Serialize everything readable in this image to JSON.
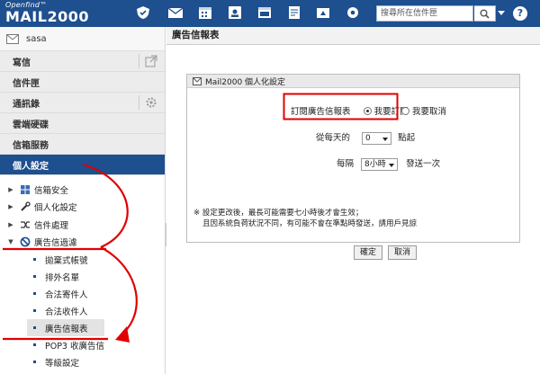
{
  "brand": {
    "top": "Openfind™",
    "name": "MAIL2000"
  },
  "search": {
    "placeholder": "搜尋所在信件匣"
  },
  "help": {
    "label": "?"
  },
  "user": {
    "name": "sasa"
  },
  "nav": {
    "items": [
      {
        "label": "寫信"
      },
      {
        "label": "信件匣"
      },
      {
        "label": "通訊錄"
      },
      {
        "label": "雲端硬碟"
      },
      {
        "label": "信箱服務"
      },
      {
        "label": "個人設定"
      }
    ]
  },
  "tree": {
    "items": [
      {
        "label": "信箱安全"
      },
      {
        "label": "個人化設定"
      },
      {
        "label": "信件處理"
      },
      {
        "label": "廣告信過濾"
      }
    ],
    "subitems": [
      {
        "label": "拋棄式帳號"
      },
      {
        "label": "排外名單"
      },
      {
        "label": "合法寄件人"
      },
      {
        "label": "合法收件人"
      },
      {
        "label": "廣告信報表"
      },
      {
        "label": "POP3 收廣告信"
      },
      {
        "label": "等級設定"
      }
    ]
  },
  "main": {
    "title": "廣告信報表",
    "panel_title": "Mail2000 個人化設定",
    "subscribe_label": "訂閱廣告信報表",
    "opt_subscribe": "我要訂閱",
    "opt_cancel": "我要取消",
    "daily_prefix": "從每天的",
    "daily_value": "0",
    "daily_suffix": "點起",
    "every_prefix": "每隔",
    "every_value": "8小時",
    "every_suffix": "發送一次",
    "note_line1": "※ 設定更改後，最長可能需要七小時後才會生效；",
    "note_line2": "且因系統負荷狀況不同，有可能不會在準點時發送，請用戶見諒",
    "ok": "確定",
    "cancel": "取消"
  },
  "colors": {
    "brand": "#1e4f8e",
    "annotation": "#e00000"
  }
}
